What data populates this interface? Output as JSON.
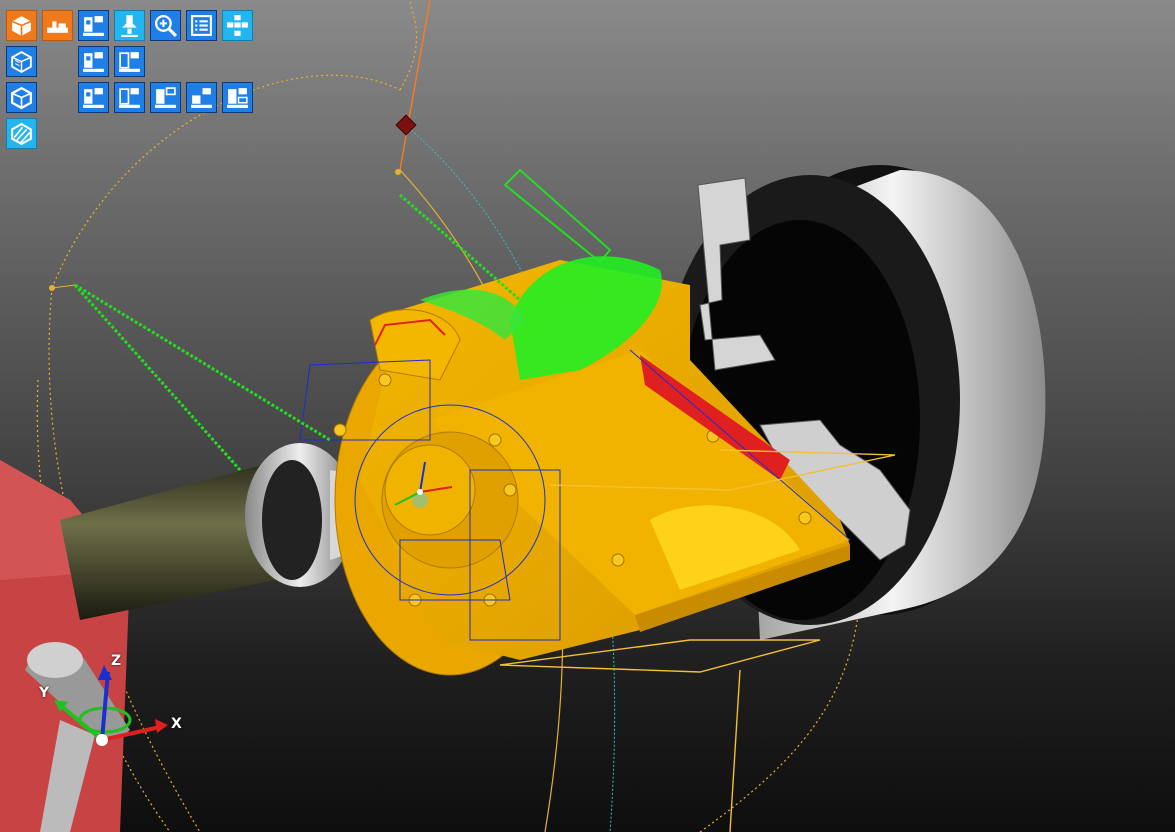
{
  "viewport": {
    "background_top": "#8a8a8a",
    "background_bottom": "#0e0e0e"
  },
  "toolbar": {
    "row1": [
      {
        "icon": "solid-cube-icon",
        "color": "#f07a1a"
      },
      {
        "icon": "machine-bed-icon",
        "color": "#f07a1a"
      },
      {
        "icon": "machine-view-icon",
        "color": "#1f7fe6"
      },
      {
        "icon": "spindle-tool-icon",
        "color": "#23b5ef"
      },
      {
        "icon": "zoom-fit-icon",
        "color": "#1f7fe6"
      },
      {
        "icon": "list-icon",
        "color": "#1f7fe6"
      },
      {
        "icon": "view-layout-icon",
        "color": "#23b5ef"
      }
    ],
    "row2": [
      {
        "icon": "wireframe-cube-icon",
        "color": "#1f7fe6"
      },
      {
        "icon": "machine-view-icon",
        "color": "#1f7fe6"
      },
      {
        "icon": "machine-view-icon",
        "color": "#1f7fe6"
      }
    ],
    "row3": [
      {
        "icon": "outline-cube-icon",
        "color": "#1f7fe6"
      },
      {
        "icon": "machine-view-icon",
        "color": "#1f7fe6"
      },
      {
        "icon": "machine-view-icon",
        "color": "#1f7fe6"
      },
      {
        "icon": "machine-view-icon",
        "color": "#1f7fe6"
      },
      {
        "icon": "machine-view-icon",
        "color": "#1f7fe6"
      },
      {
        "icon": "machine-view-icon",
        "color": "#1f7fe6"
      }
    ],
    "row4": [
      {
        "icon": "section-cube-icon",
        "color": "#23b5ef"
      }
    ]
  },
  "axis_triad": {
    "x": "X",
    "y": "Y",
    "z": "Z"
  },
  "colors": {
    "part": "#f2b300",
    "part_shadow": "#c98c00",
    "toolpath": "#22dd22",
    "chuck": "#d9d9d9",
    "tool_holder": "#c84444",
    "axis_x": "#e02020",
    "axis_y": "#20c020",
    "axis_z": "#1a2fd0"
  }
}
